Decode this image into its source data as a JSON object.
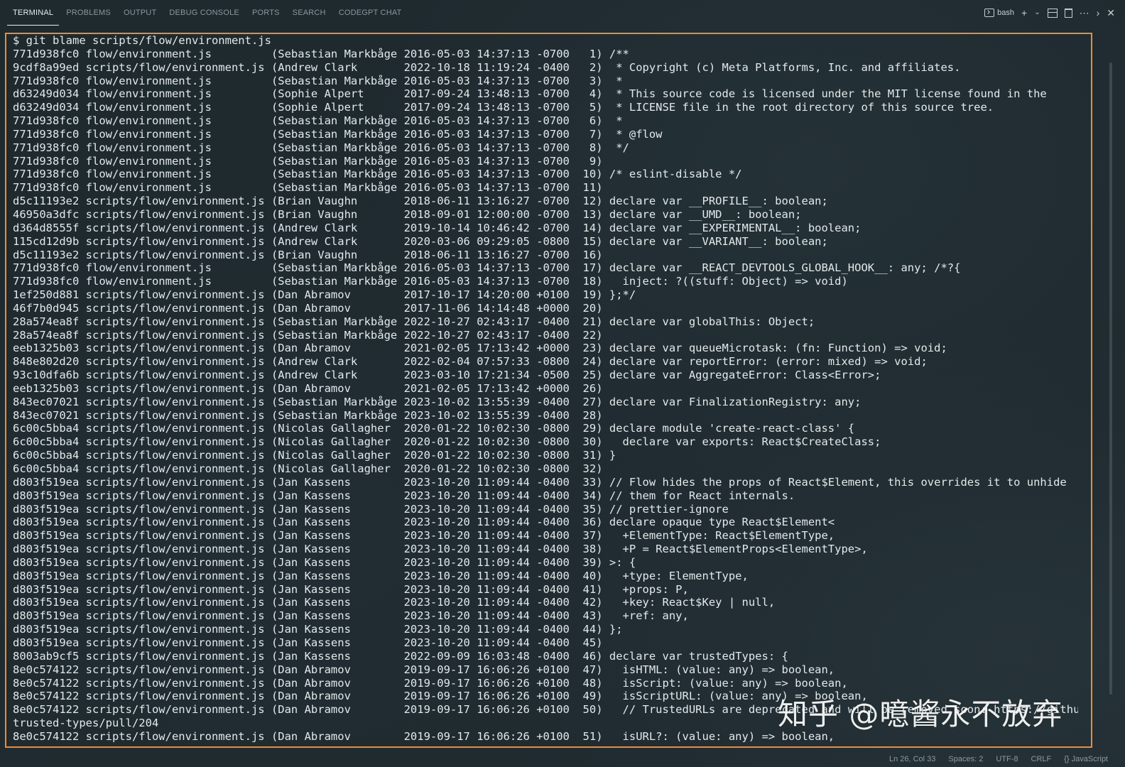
{
  "tabs": [
    "TERMINAL",
    "PROBLEMS",
    "OUTPUT",
    "DEBUG CONSOLE",
    "PORTS",
    "SEARCH",
    "CODEGPT CHAT"
  ],
  "active_tab": "TERMINAL",
  "toolbar": {
    "shell_label": "bash",
    "new_icon": "plus-icon",
    "dropdown_icon": "chevron-down-icon",
    "split_icon": "split-icon",
    "trash_icon": "trash-icon",
    "more_icon": "ellipsis-icon",
    "maximize_icon": "chevron-right-icon",
    "close_icon": "close-icon"
  },
  "terminal": {
    "lines": [
      "$ git blame scripts/flow/environment.js",
      "771d938fc0 flow/environment.js         (Sebastian Markbåge 2016-05-03 14:37:13 -0700   1) /**",
      "9cdf8a99ed scripts/flow/environment.js (Andrew Clark       2022-10-18 11:19:24 -0400   2)  * Copyright (c) Meta Platforms, Inc. and affiliates.",
      "771d938fc0 flow/environment.js         (Sebastian Markbåge 2016-05-03 14:37:13 -0700   3)  *",
      "d63249d034 flow/environment.js         (Sophie Alpert      2017-09-24 13:48:13 -0700   4)  * This source code is licensed under the MIT license found in the",
      "d63249d034 flow/environment.js         (Sophie Alpert      2017-09-24 13:48:13 -0700   5)  * LICENSE file in the root directory of this source tree.",
      "771d938fc0 flow/environment.js         (Sebastian Markbåge 2016-05-03 14:37:13 -0700   6)  *",
      "771d938fc0 flow/environment.js         (Sebastian Markbåge 2016-05-03 14:37:13 -0700   7)  * @flow",
      "771d938fc0 flow/environment.js         (Sebastian Markbåge 2016-05-03 14:37:13 -0700   8)  */",
      "771d938fc0 flow/environment.js         (Sebastian Markbåge 2016-05-03 14:37:13 -0700   9)",
      "771d938fc0 flow/environment.js         (Sebastian Markbåge 2016-05-03 14:37:13 -0700  10) /* eslint-disable */",
      "771d938fc0 flow/environment.js         (Sebastian Markbåge 2016-05-03 14:37:13 -0700  11)",
      "d5c11193e2 scripts/flow/environment.js (Brian Vaughn       2018-06-11 13:16:27 -0700  12) declare var __PROFILE__: boolean;",
      "46950a3dfc scripts/flow/environment.js (Brian Vaughn       2018-09-01 12:00:00 -0700  13) declare var __UMD__: boolean;",
      "d364d8555f scripts/flow/environment.js (Andrew Clark       2019-10-14 10:46:42 -0700  14) declare var __EXPERIMENTAL__: boolean;",
      "115cd12d9b scripts/flow/environment.js (Andrew Clark       2020-03-06 09:29:05 -0800  15) declare var __VARIANT__: boolean;",
      "d5c11193e2 scripts/flow/environment.js (Brian Vaughn       2018-06-11 13:16:27 -0700  16)",
      "771d938fc0 flow/environment.js         (Sebastian Markbåge 2016-05-03 14:37:13 -0700  17) declare var __REACT_DEVTOOLS_GLOBAL_HOOK__: any; /*?{",
      "771d938fc0 flow/environment.js         (Sebastian Markbåge 2016-05-03 14:37:13 -0700  18)   inject: ?((stuff: Object) => void)",
      "1ef250d881 scripts/flow/environment.js (Dan Abramov        2017-10-17 14:20:00 +0100  19) };*/",
      "46f7b0d945 scripts/flow/environment.js (Dan Abramov        2017-11-06 14:14:48 +0000  20)",
      "28a574ea8f scripts/flow/environment.js (Sebastian Markbåge 2022-10-27 02:43:17 -0400  21) declare var globalThis: Object;",
      "28a574ea8f scripts/flow/environment.js (Sebastian Markbåge 2022-10-27 02:43:17 -0400  22)",
      "eeb1325b03 scripts/flow/environment.js (Dan Abramov        2021-02-05 17:13:42 +0000  23) declare var queueMicrotask: (fn: Function) => void;",
      "848e802d20 scripts/flow/environment.js (Andrew Clark       2022-02-04 07:57:33 -0800  24) declare var reportError: (error: mixed) => void;",
      "93c10dfa6b scripts/flow/environment.js (Andrew Clark       2023-03-10 17:21:34 -0500  25) declare var AggregateError: Class<Error>;",
      "eeb1325b03 scripts/flow/environment.js (Dan Abramov        2021-02-05 17:13:42 +0000  26)",
      "843ec07021 scripts/flow/environment.js (Sebastian Markbåge 2023-10-02 13:55:39 -0400  27) declare var FinalizationRegistry: any;",
      "843ec07021 scripts/flow/environment.js (Sebastian Markbåge 2023-10-02 13:55:39 -0400  28)",
      "6c00c5bba4 scripts/flow/environment.js (Nicolas Gallagher  2020-01-22 10:02:30 -0800  29) declare module 'create-react-class' {",
      "6c00c5bba4 scripts/flow/environment.js (Nicolas Gallagher  2020-01-22 10:02:30 -0800  30)   declare var exports: React$CreateClass;",
      "6c00c5bba4 scripts/flow/environment.js (Nicolas Gallagher  2020-01-22 10:02:30 -0800  31) }",
      "6c00c5bba4 scripts/flow/environment.js (Nicolas Gallagher  2020-01-22 10:02:30 -0800  32)",
      "d803f519ea scripts/flow/environment.js (Jan Kassens        2023-10-20 11:09:44 -0400  33) // Flow hides the props of React$Element, this overrides it to unhide",
      "d803f519ea scripts/flow/environment.js (Jan Kassens        2023-10-20 11:09:44 -0400  34) // them for React internals.",
      "d803f519ea scripts/flow/environment.js (Jan Kassens        2023-10-20 11:09:44 -0400  35) // prettier-ignore",
      "d803f519ea scripts/flow/environment.js (Jan Kassens        2023-10-20 11:09:44 -0400  36) declare opaque type React$Element<",
      "d803f519ea scripts/flow/environment.js (Jan Kassens        2023-10-20 11:09:44 -0400  37)   +ElementType: React$ElementType,",
      "d803f519ea scripts/flow/environment.js (Jan Kassens        2023-10-20 11:09:44 -0400  38)   +P = React$ElementProps<ElementType>,",
      "d803f519ea scripts/flow/environment.js (Jan Kassens        2023-10-20 11:09:44 -0400  39) >: {",
      "d803f519ea scripts/flow/environment.js (Jan Kassens        2023-10-20 11:09:44 -0400  40)   +type: ElementType,",
      "d803f519ea scripts/flow/environment.js (Jan Kassens        2023-10-20 11:09:44 -0400  41)   +props: P,",
      "d803f519ea scripts/flow/environment.js (Jan Kassens        2023-10-20 11:09:44 -0400  42)   +key: React$Key | null,",
      "d803f519ea scripts/flow/environment.js (Jan Kassens        2023-10-20 11:09:44 -0400  43)   +ref: any,",
      "d803f519ea scripts/flow/environment.js (Jan Kassens        2023-10-20 11:09:44 -0400  44) };",
      "d803f519ea scripts/flow/environment.js (Jan Kassens        2023-10-20 11:09:44 -0400  45)",
      "8003ab9cf5 scripts/flow/environment.js (Jan Kassens        2022-09-09 16:03:48 -0400  46) declare var trustedTypes: {",
      "8e0c574122 scripts/flow/environment.js (Dan Abramov        2019-09-17 16:06:26 +0100  47)   isHTML: (value: any) => boolean,",
      "8e0c574122 scripts/flow/environment.js (Dan Abramov        2019-09-17 16:06:26 +0100  48)   isScript: (value: any) => boolean,",
      "8e0c574122 scripts/flow/environment.js (Dan Abramov        2019-09-17 16:06:26 +0100  49)   isScriptURL: (value: any) => boolean,",
      "8e0c574122 scripts/flow/environment.js (Dan Abramov        2019-09-17 16:06:26 +0100  50)   // TrustedURLs are deprecated and will be removed soon: https://github.com/WICG/",
      "trusted-types/pull/204",
      "8e0c574122 scripts/flow/environment.js (Dan Abramov        2019-09-17 16:06:26 +0100  51)   isURL?: (value: any) => boolean,"
    ]
  },
  "watermark": "知乎 @噫酱永不放弃",
  "statusbar": {
    "position": "Ln 26, Col 33",
    "spaces": "Spaces: 2",
    "encoding": "UTF-8",
    "eol": "CRLF",
    "language": "{} JavaScript"
  },
  "colors": {
    "frame": "#f08a33",
    "background": "#1f2a2f",
    "text": "#e3e9eb"
  }
}
